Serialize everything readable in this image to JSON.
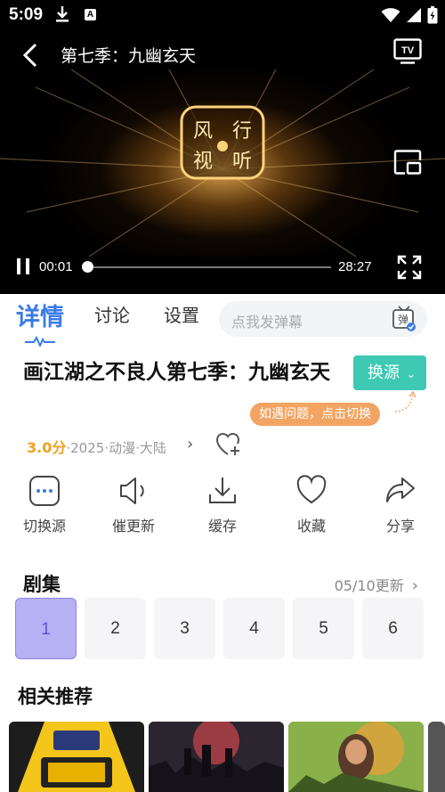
{
  "status_bar": {
    "time": "5:09"
  },
  "player": {
    "title": "第七季：九幽玄天",
    "current_time": "00:01",
    "duration": "28:27",
    "progress": 0.0006,
    "logo_text": "风行视听"
  },
  "tabs": [
    {
      "label": "详情",
      "active": true
    },
    {
      "label": "讨论",
      "active": false
    },
    {
      "label": "设置",
      "active": false
    }
  ],
  "danmu": {
    "placeholder": "点我发弹幕",
    "icon_label": "弹"
  },
  "show": {
    "title": "画江湖之不良人第七季：九幽玄天",
    "score": "3.0分",
    "meta": "·2025·动漫·大陆",
    "source_button": "换源",
    "tip": "如遇问题，点击切换"
  },
  "actions": [
    {
      "label": "切换源",
      "icon": "more-icon"
    },
    {
      "label": "催更新",
      "icon": "speaker-icon"
    },
    {
      "label": "缓存",
      "icon": "download-icon"
    },
    {
      "label": "收藏",
      "icon": "heart-icon"
    },
    {
      "label": "分享",
      "icon": "share-icon"
    }
  ],
  "episodes": {
    "heading": "剧集",
    "update": "05/10更新",
    "items": [
      "1",
      "2",
      "3",
      "4",
      "5",
      "6"
    ],
    "selected": "1"
  },
  "recommend": {
    "heading": "相关推荐"
  },
  "colors": {
    "accent": "#3b7be6",
    "source_btn": "#3dc9b3",
    "tip": "#f2a462",
    "score": "#f0a021",
    "episode_active": "#b6b0f4"
  }
}
